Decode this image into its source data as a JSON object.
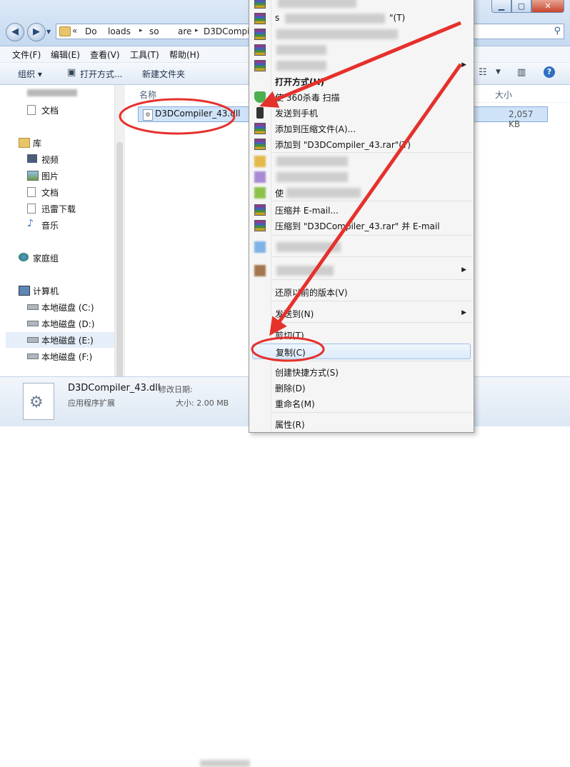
{
  "address": {
    "crumbs": [
      "Do",
      "loads",
      "so",
      "are",
      "D3DCompi"
    ],
    "chevron": "«"
  },
  "menubar": [
    {
      "label": "文件(F)"
    },
    {
      "label": "编辑(E)"
    },
    {
      "label": "查看(V)"
    },
    {
      "label": "工具(T)"
    },
    {
      "label": "帮助(H)"
    }
  ],
  "toolbar": {
    "organize": "组织 ▾",
    "open_with": "打开方式...",
    "new_folder": "新建文件夹"
  },
  "sidebar": {
    "items": [
      {
        "label": "文档",
        "icon": "document-icon"
      },
      {
        "label": "库",
        "icon": "library-icon"
      },
      {
        "label": "视频",
        "icon": "video-icon"
      },
      {
        "label": "图片",
        "icon": "picture-icon"
      },
      {
        "label": "文档",
        "icon": "document-icon"
      },
      {
        "label": "迅雷下载",
        "icon": "download-icon"
      },
      {
        "label": "音乐",
        "icon": "music-icon"
      },
      {
        "label": "家庭组",
        "icon": "homegroup-icon"
      },
      {
        "label": "计算机",
        "icon": "computer-icon"
      },
      {
        "label": "本地磁盘 (C:)",
        "icon": "drive-icon"
      },
      {
        "label": "本地磁盘 (D:)",
        "icon": "drive-icon"
      },
      {
        "label": "本地磁盘 (E:)",
        "icon": "drive-icon"
      },
      {
        "label": "本地磁盘 (F:)",
        "icon": "drive-icon"
      }
    ]
  },
  "content": {
    "column_name": "名称",
    "column_size": "大小",
    "file": {
      "name": "D3DCompiler_43.dll",
      "size": "2,057 KB"
    }
  },
  "details": {
    "name": "D3DCompiler_43.dll",
    "modified_label": "修改日期:",
    "type": "应用程序扩展",
    "size": "大小: 2.00 MB"
  },
  "context_menu": {
    "items": [
      {
        "label": "s",
        "icon": "rar-icon"
      },
      {
        "label": "\"(T)",
        "icon": "rar-icon"
      },
      {
        "label": "",
        "icon": "rar-icon"
      },
      {
        "label": "",
        "icon": "rar-icon"
      },
      {
        "label": "",
        "icon": "rar-icon"
      },
      {
        "label": "打开方式(H)",
        "icon": ""
      },
      {
        "label": "使 360杀毒 扫描",
        "icon": "shield-icon"
      },
      {
        "label": "发送到手机",
        "icon": "phone-icon"
      },
      {
        "label": "添加到压缩文件(A)...",
        "icon": "rar-icon"
      },
      {
        "label": "添加到 \"D3DCompiler_43.rar\"(T)",
        "icon": "rar-icon"
      },
      {
        "label": "",
        "icon": "gold-icon"
      },
      {
        "label": "",
        "icon": "purple-icon"
      },
      {
        "label": "使",
        "icon": "green-icon"
      },
      {
        "label": "压缩并 E-mail...",
        "icon": "rar-icon"
      },
      {
        "label": "压缩到 \"D3DCompiler_43.rar\" 并 E-mail",
        "icon": "rar-icon"
      },
      {
        "label": "",
        "icon": "blue-icon"
      },
      {
        "label": "",
        "icon": "brown-icon"
      },
      {
        "label": "还原以前的版本(V)",
        "icon": ""
      },
      {
        "label": "发送到(N)",
        "icon": ""
      },
      {
        "label": "剪切(T)",
        "icon": ""
      },
      {
        "label": "复制(C)",
        "icon": ""
      },
      {
        "label": "创建快捷方式(S)",
        "icon": ""
      },
      {
        "label": "删除(D)",
        "icon": ""
      },
      {
        "label": "重命名(M)",
        "icon": ""
      },
      {
        "label": "属性(R)",
        "icon": ""
      }
    ]
  },
  "colors": {
    "annotation_red": "#e5312b",
    "selection_blue": "#cfe3f8",
    "menu_bg": "#f5f5f5"
  }
}
